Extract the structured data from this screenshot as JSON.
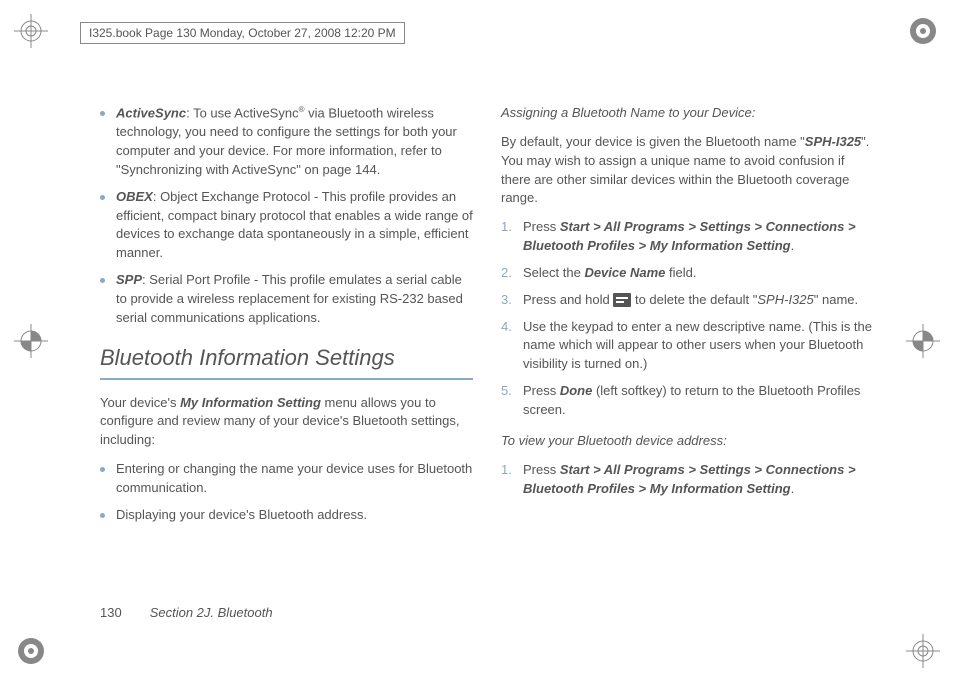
{
  "header": {
    "text": "I325.book  Page 130  Monday, October 27, 2008  12:20 PM"
  },
  "left_column": {
    "profiles": [
      {
        "term": "ActiveSync",
        "sup": "®",
        "desc_before": ": To use ActiveSync",
        "desc_after": " via Bluetooth wireless technology, you need to configure the settings for both your computer and your device. For more information, refer to \"Synchronizing with ActiveSync\" on page 144."
      },
      {
        "term": "OBEX",
        "desc": ": Object Exchange Protocol - This profile provides an efficient, compact binary protocol that enables a wide range of devices to exchange data spontaneously in a simple, efficient manner."
      },
      {
        "term": "SPP",
        "desc": ": Serial Port Profile - This profile emulates a serial cable to provide a wireless replacement for existing RS-232 based serial communications applications."
      }
    ],
    "section_heading": "Bluetooth Information Settings",
    "intro_before": "Your device's ",
    "intro_term": "My Information Setting",
    "intro_after": " menu allows you to configure and review many of your device's Bluetooth settings, including:",
    "settings_bullets": [
      "Entering or changing the name your device uses for Bluetooth communication.",
      "Displaying your device's Bluetooth address."
    ]
  },
  "right_column": {
    "assign_heading": "Assigning a Bluetooth Name to your Device:",
    "assign_intro_before": "By default, your device is given the Bluetooth name \"",
    "assign_intro_term": "SPH-I325",
    "assign_intro_after": "\". You may wish to assign a unique name to avoid confusion if there are other similar devices within the Bluetooth coverage range.",
    "steps": {
      "s1_before": "Press ",
      "s1_path": "Start > All Programs > Settings > Connections > Bluetooth Profiles > My Information Setting",
      "s1_after": ".",
      "s2_before": "Select the ",
      "s2_term": "Device Name",
      "s2_after": " field.",
      "s3_before": "Press and hold ",
      "s3_mid": " to delete the default \"",
      "s3_term": "SPH-I325",
      "s3_after": "\" name.",
      "s4": "Use the keypad to enter a new descriptive name. (This is the name which will appear to other users when your Bluetooth visibility is turned on.)",
      "s5_before": "Press ",
      "s5_term": "Done",
      "s5_after": " (left softkey) to return to the Bluetooth Profiles screen."
    },
    "view_heading": "To view your Bluetooth device address:",
    "view_step_before": "Press ",
    "view_step_path": "Start > All Programs > Settings > Connections > Bluetooth Profiles > My Information Setting",
    "view_step_after": "."
  },
  "footer": {
    "page_number": "130",
    "section": "Section 2J. Bluetooth"
  }
}
